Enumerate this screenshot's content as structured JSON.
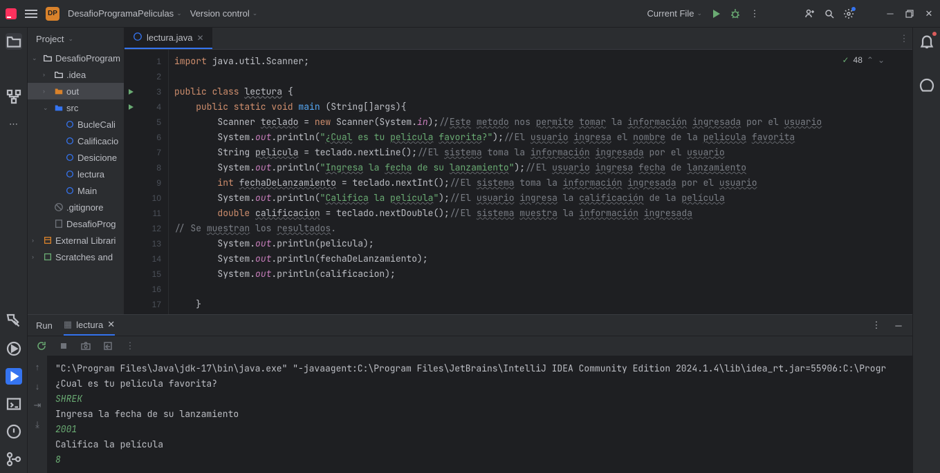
{
  "titlebar": {
    "project_name": "DesafioProgramaPeliculas",
    "project_badge": "DP",
    "vcs": "Version control",
    "run_config": "Current File"
  },
  "project_panel": {
    "title": "Project",
    "items": [
      {
        "label": "DesafioProgram",
        "icon": "folder-root",
        "depth": 0,
        "arrow": "v"
      },
      {
        "label": ".idea",
        "icon": "folder",
        "depth": 1,
        "arrow": ">"
      },
      {
        "label": "out",
        "icon": "folder-orange",
        "depth": 1,
        "arrow": ">",
        "selected": true
      },
      {
        "label": "src",
        "icon": "folder-blue",
        "depth": 1,
        "arrow": "v"
      },
      {
        "label": "BucleCali",
        "icon": "java",
        "depth": 2
      },
      {
        "label": "Calificacio",
        "icon": "java",
        "depth": 2
      },
      {
        "label": "Desicione",
        "icon": "java",
        "depth": 2
      },
      {
        "label": "lectura",
        "icon": "java",
        "depth": 2
      },
      {
        "label": "Main",
        "icon": "java",
        "depth": 2
      },
      {
        "label": ".gitignore",
        "icon": "gitignore",
        "depth": 1
      },
      {
        "label": "DesafioProg",
        "icon": "iml",
        "depth": 1
      },
      {
        "label": "External Librari",
        "icon": "lib",
        "depth": 0,
        "arrow": ">"
      },
      {
        "label": "Scratches and",
        "icon": "scratch",
        "depth": 0,
        "arrow": ">"
      }
    ]
  },
  "editor": {
    "tab": "lectura.java",
    "problems": "48",
    "gutter": [
      "1",
      "2",
      "3",
      "4",
      "5",
      "6",
      "7",
      "8",
      "9",
      "10",
      "11",
      "12",
      "13",
      "14",
      "15",
      "16",
      "17"
    ],
    "run_markers": {
      "3": true,
      "4": true
    }
  },
  "run": {
    "title": "Run",
    "tab": "lectura",
    "console_cmd": "\"C:\\Program Files\\Java\\jdk-17\\bin\\java.exe\" \"-javaagent:C:\\Program Files\\JetBrains\\IntelliJ IDEA Community Edition 2024.1.4\\lib\\idea_rt.jar=55906:C:\\Progr",
    "lines": [
      {
        "t": "¿Cual es tu pelicula favorita?",
        "k": "out"
      },
      {
        "t": "SHREK",
        "k": "in"
      },
      {
        "t": "Ingresa la fecha de su lanzamiento",
        "k": "out"
      },
      {
        "t": "2001",
        "k": "in"
      },
      {
        "t": "Califica la película",
        "k": "out"
      },
      {
        "t": "8",
        "k": "in"
      }
    ]
  }
}
